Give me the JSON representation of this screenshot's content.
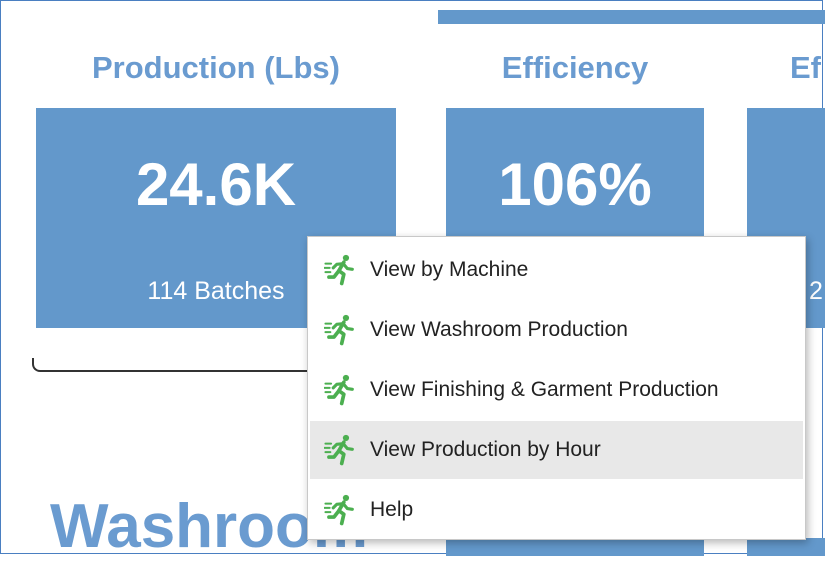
{
  "cards": [
    {
      "header": "Production (Lbs)",
      "value": "24.6K",
      "sub": "114 Batches"
    },
    {
      "header": "Efficiency",
      "value": "106%",
      "sub": ""
    },
    {
      "header": "Ef",
      "value": "",
      "sub": "2"
    }
  ],
  "section_title": "Washroom",
  "context_menu": {
    "items": [
      {
        "label": "View by Machine",
        "icon": "running-person-icon"
      },
      {
        "label": "View Washroom Production",
        "icon": "running-person-icon"
      },
      {
        "label": "View Finishing & Garment Production",
        "icon": "running-person-icon"
      },
      {
        "label": "View Production by Hour",
        "icon": "running-person-icon",
        "hovered": true
      },
      {
        "label": "Help",
        "icon": "running-person-icon"
      }
    ]
  },
  "colors": {
    "tile": "#6398cb",
    "header_text": "#6a9bd0",
    "icon": "#4caf50",
    "hover": "#e8e8e8"
  }
}
